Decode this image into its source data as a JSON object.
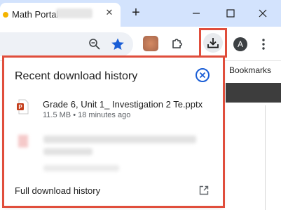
{
  "browser": {
    "tab": {
      "title": "Math Portal"
    },
    "icons": [
      "favicon",
      "close-icon",
      "plus-icon",
      "minimize-icon",
      "maximize-icon",
      "window-close-icon",
      "zoom-icon",
      "star-icon",
      "extension-thumbnail",
      "puzzle-icon",
      "download-icon",
      "more-vert-icon"
    ],
    "profile_initial": "A",
    "accent_color": "#1a5ed6",
    "highlight_color": "#e04e3c"
  },
  "page": {
    "bookmarks_label": "Bookmarks"
  },
  "download_panel": {
    "title": "Recent download history",
    "items": [
      {
        "file_name": "Grade 6, Unit 1_ Investigation 2 Te.pptx",
        "meta": "11.5 MB • 18 minutes ago",
        "icon": "pptx-file-icon"
      }
    ],
    "footer_link": "Full download history"
  }
}
